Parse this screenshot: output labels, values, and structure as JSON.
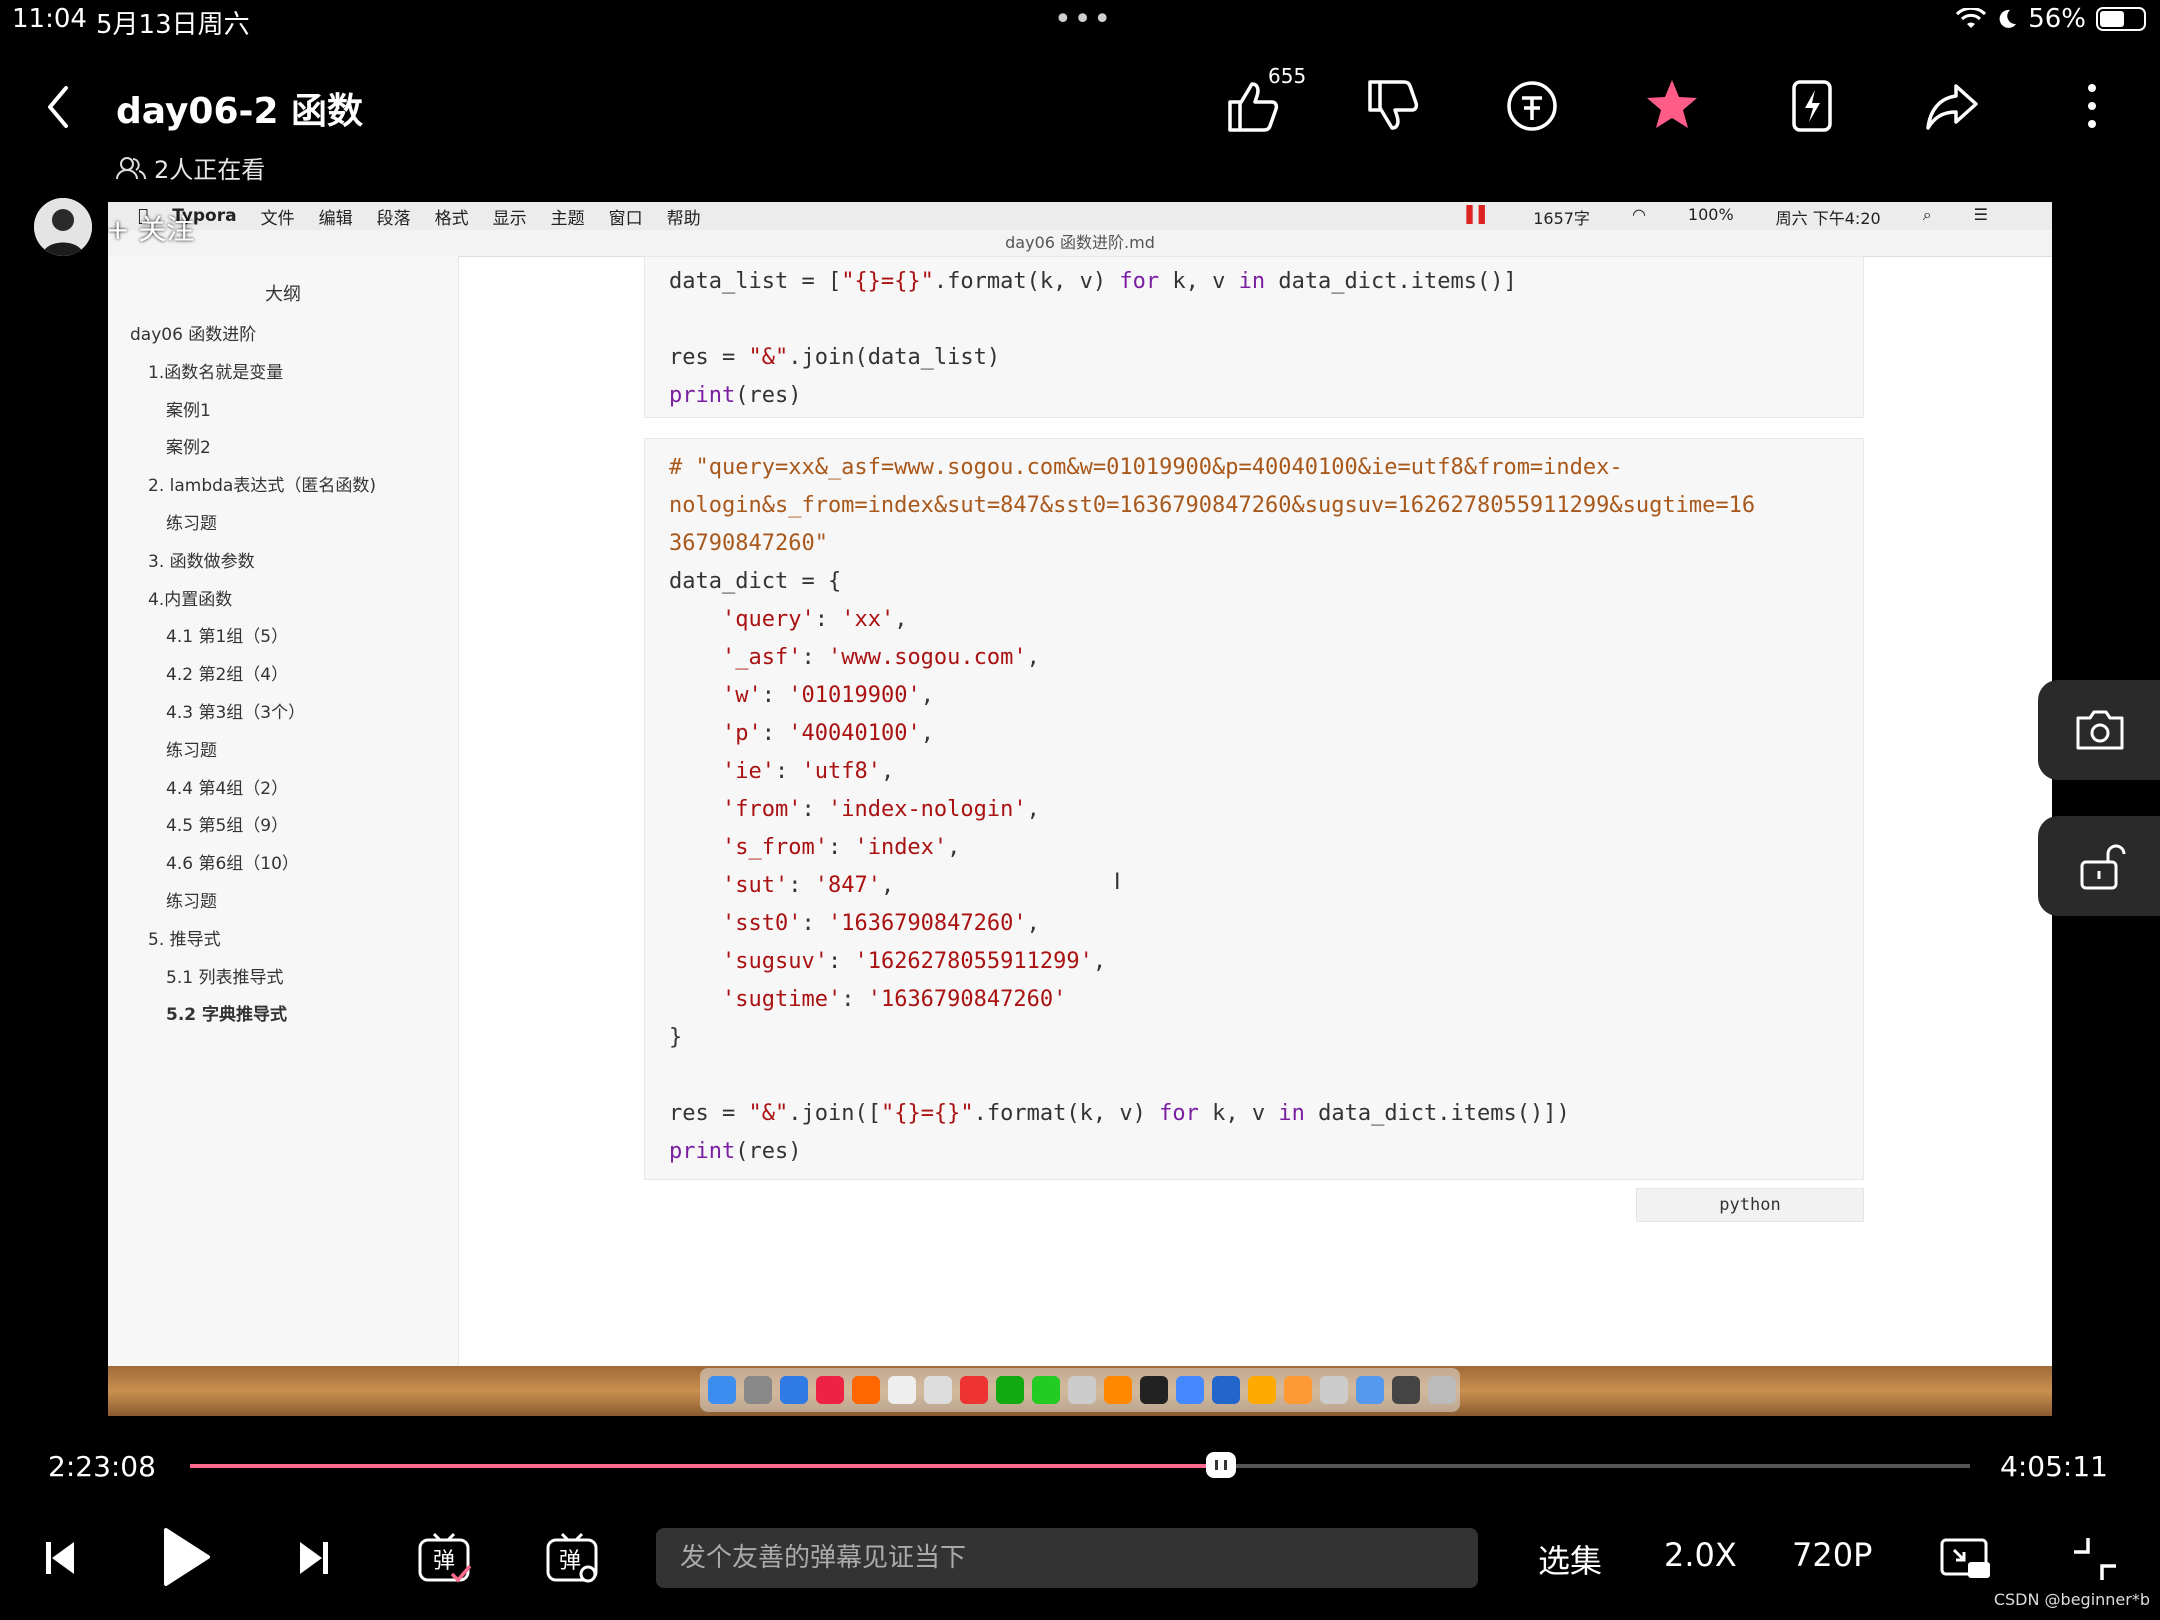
{
  "status": {
    "time": "11:04",
    "date": "5月13日周六",
    "dots": "•••",
    "battery": "56%",
    "battery_level": 0.56
  },
  "header": {
    "title": "day06-2 函数",
    "viewers": "2人正在看",
    "like_count": "655"
  },
  "uploader": {
    "follow_label": "+ 关注"
  },
  "typora": {
    "menu": [
      "Typora",
      "文件",
      "编辑",
      "段落",
      "格式",
      "显示",
      "主题",
      "窗口",
      "帮助"
    ],
    "status_items": {
      "words": "1657字",
      "battery": "100%",
      "clock": "周六 下午4:20"
    },
    "window_title": "day06 函数进阶.md",
    "outline_title": "大纲",
    "outline": [
      {
        "label": "day06 函数进阶",
        "level": 0
      },
      {
        "label": "1.函数名就是变量",
        "level": 1
      },
      {
        "label": "案例1",
        "level": 2
      },
      {
        "label": "案例2",
        "level": 2
      },
      {
        "label": "2. lambda表达式（匿名函数)",
        "level": 1
      },
      {
        "label": "练习题",
        "level": 2
      },
      {
        "label": "3. 函数做参数",
        "level": 1
      },
      {
        "label": "4.内置函数",
        "level": 1
      },
      {
        "label": "4.1 第1组（5）",
        "level": 2
      },
      {
        "label": "4.2 第2组（4）",
        "level": 2
      },
      {
        "label": "4.3 第3组（3个）",
        "level": 2
      },
      {
        "label": "练习题",
        "level": 2
      },
      {
        "label": "4.4 第4组（2）",
        "level": 2
      },
      {
        "label": "4.5 第5组（9）",
        "level": 2
      },
      {
        "label": "4.6 第6组（10）",
        "level": 2
      },
      {
        "label": "练习题",
        "level": 2
      },
      {
        "label": "5. 推导式",
        "level": 1
      },
      {
        "label": "5.1 列表推导式",
        "level": 2
      },
      {
        "label": "5.2 字典推导式",
        "level": 2,
        "active": true
      }
    ],
    "code_block_1": [
      "data_list = [\"{}={}\".format(k, v) for k, v in data_dict.items()]",
      "",
      "res = \"&\".join(data_list)",
      "print(res)"
    ],
    "code_block_2_comment": [
      "# \"query=xx&_asf=www.sogou.com&w=01019900&p=40040100&ie=utf8&from=index-",
      "nologin&s_from=index&sut=847&sst0=1636790847260&sugsuv=1626278055911299&sugtime=16",
      "36790847260\""
    ],
    "code_block_2": [
      "data_dict = {",
      "    'query': 'xx',",
      "    '_asf': 'www.sogou.com',",
      "    'w': '01019900',",
      "    'p': '40040100',",
      "    'ie': 'utf8',",
      "    'from': 'index-nologin',",
      "    's_from': 'index',",
      "    'sut': '847',",
      "    'sst0': '1636790847260',",
      "    'sugsuv': '1626278055911299',",
      "    'sugtime': '1636790847260'",
      "}",
      "",
      "res = \"&\".join([\"{}={}\".format(k, v) for k, v in data_dict.items()])",
      "print(res)"
    ],
    "language_label": "python"
  },
  "player": {
    "current_time": "2:23:08",
    "total_time": "4:05:11",
    "progress": 0.5794,
    "danmaku_placeholder": "发个友善的弹幕见证当下",
    "episodes_label": "选集",
    "speed_label": "2.0X",
    "quality_label": "720P"
  },
  "watermark": "CSDN @beginner*b",
  "colors": {
    "accent": "#ff6a8e",
    "star": "#ff5c8a",
    "comment": "#a9581b",
    "string": "#aa1111",
    "keyword": "#7a1fa2"
  }
}
